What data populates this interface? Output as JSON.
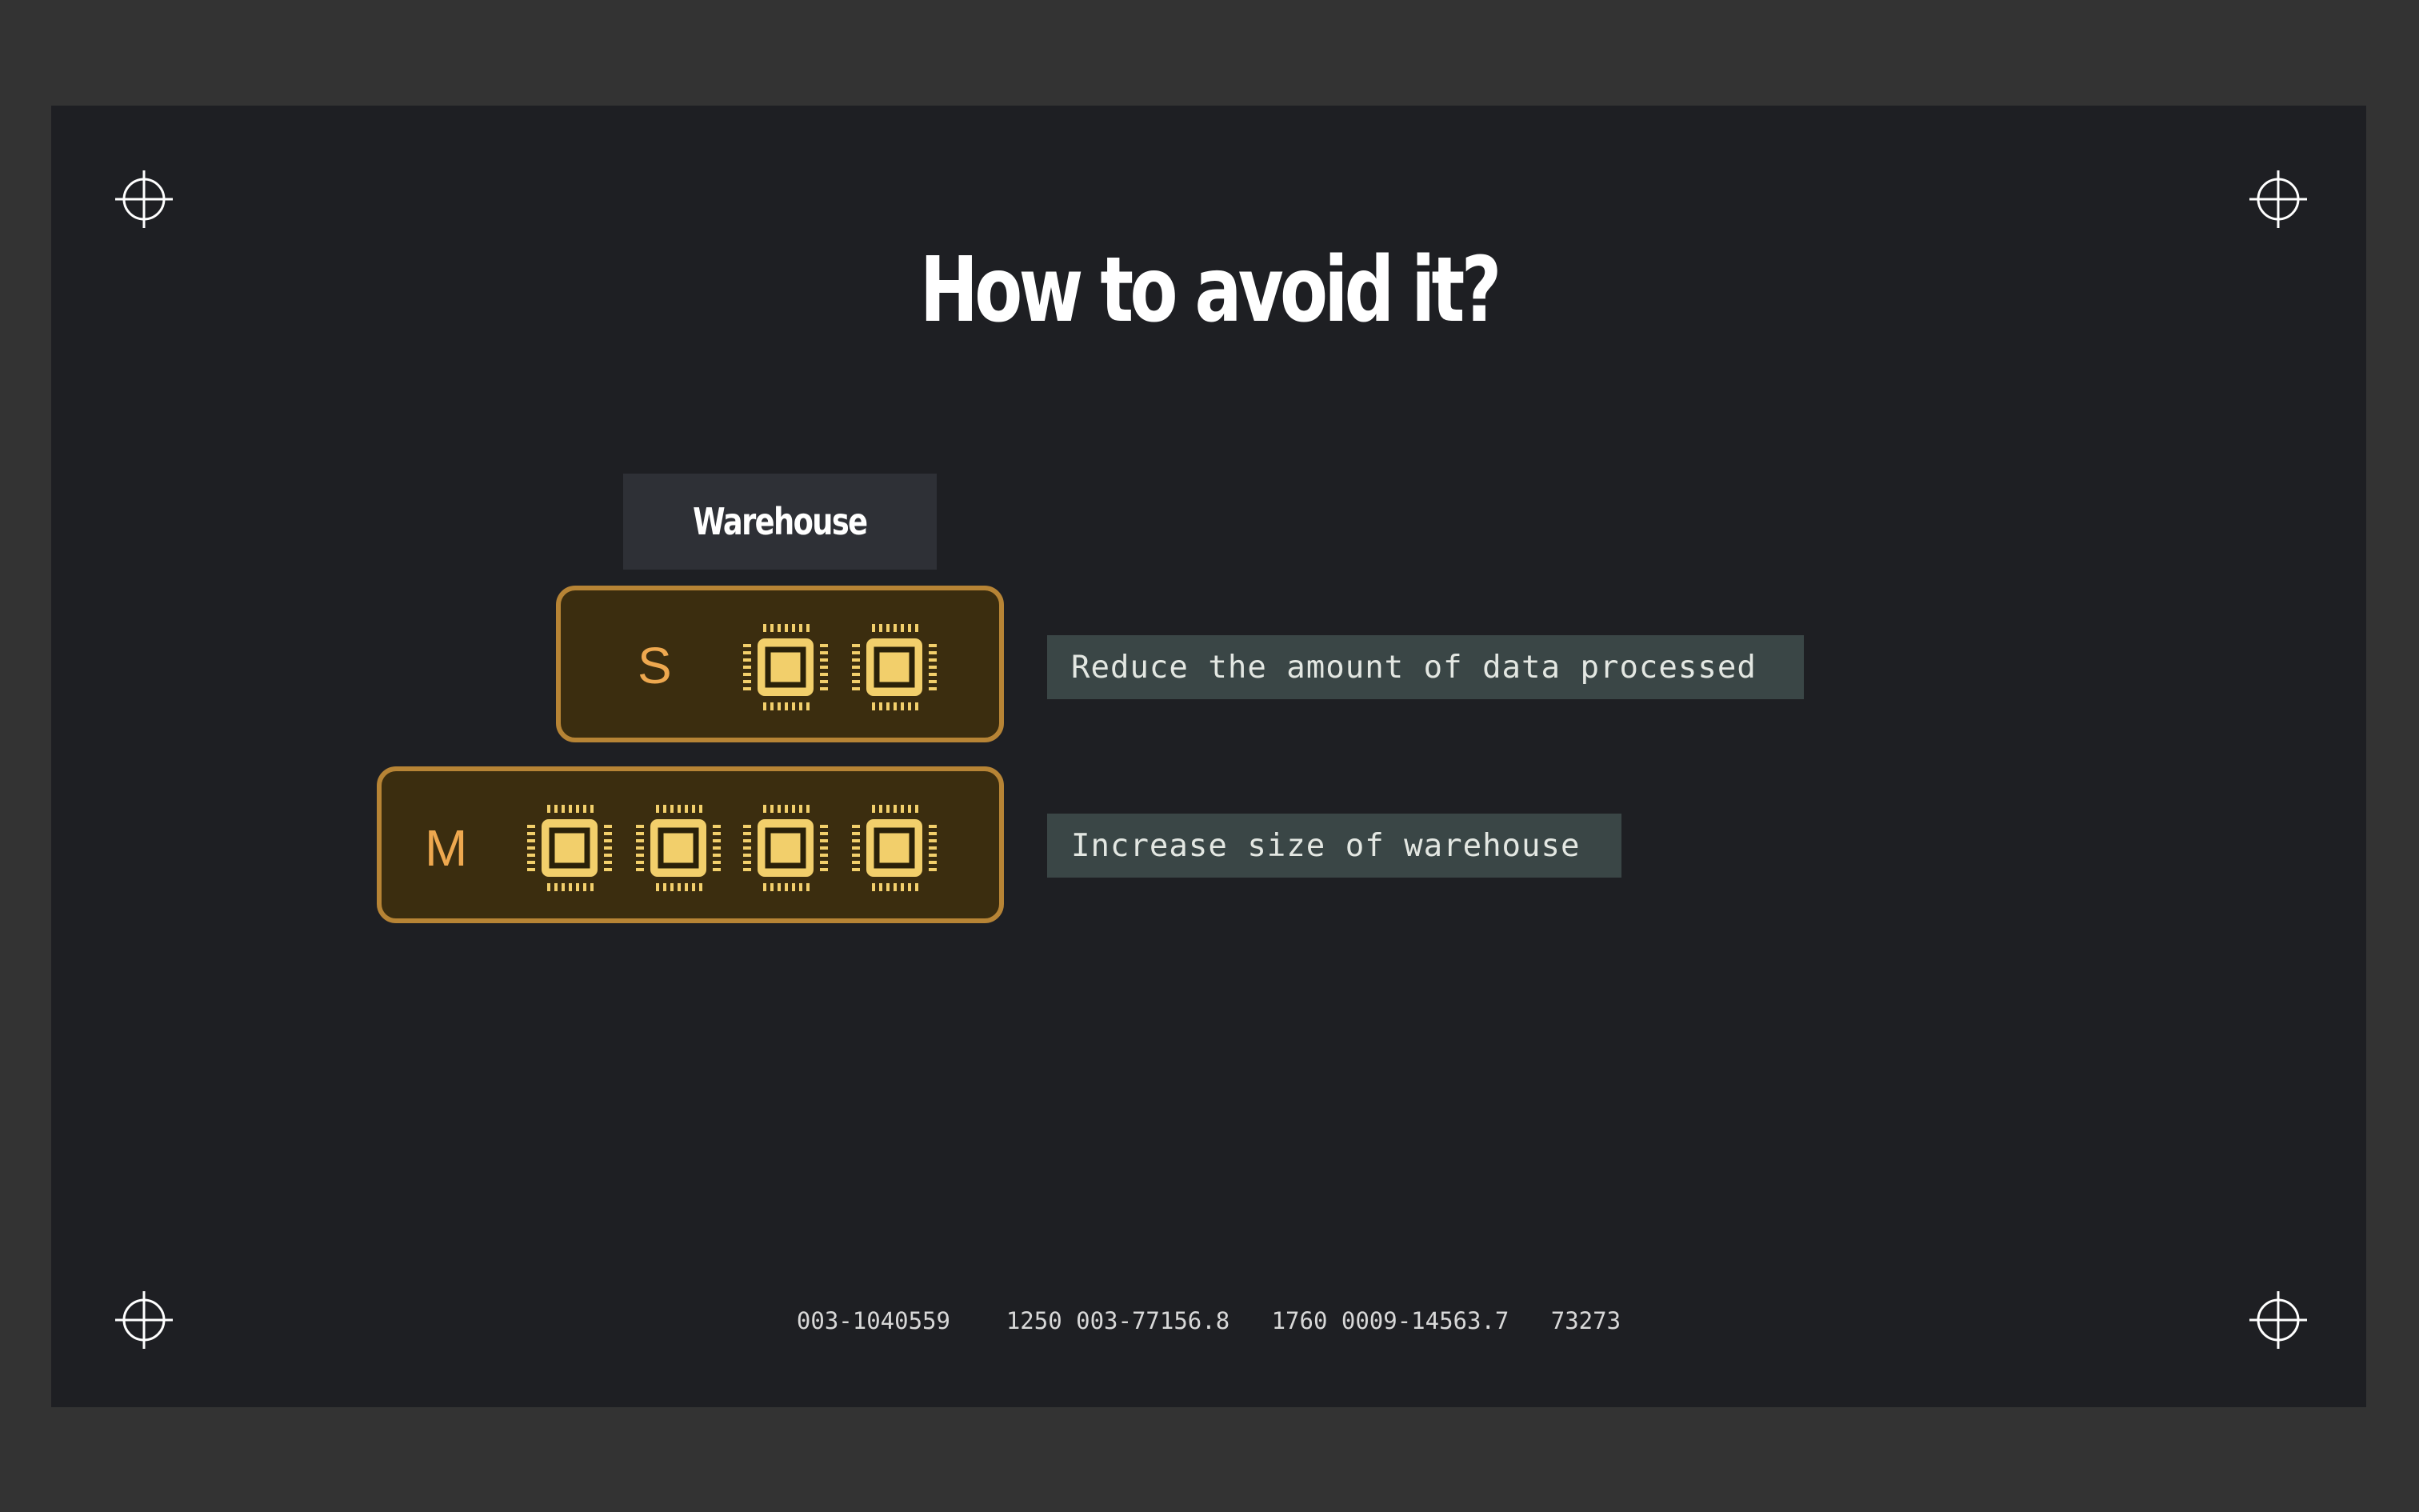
{
  "slide": {
    "title": "How to avoid it?",
    "warehouse_label": "Warehouse",
    "sizes": [
      {
        "letter": "S",
        "chips": 2
      },
      {
        "letter": "M",
        "chips": 4
      }
    ],
    "tips": [
      "Reduce the amount of data processed",
      "Increase size of warehouse"
    ],
    "footer": {
      "codes": [
        "003-1040559",
        "1250 003-77156.8",
        "1760 0009-14563.7",
        "73273"
      ]
    }
  },
  "colors": {
    "background": "#333333",
    "slide": "#1e1f23",
    "accent_border": "#b78435",
    "box_fill": "#3b2d0f",
    "letter": "#eea84f",
    "chip": "#f2cf6b",
    "tip_bg": "#3a4646"
  },
  "icons": [
    "crosshair-icon",
    "cpu-chip-icon"
  ]
}
